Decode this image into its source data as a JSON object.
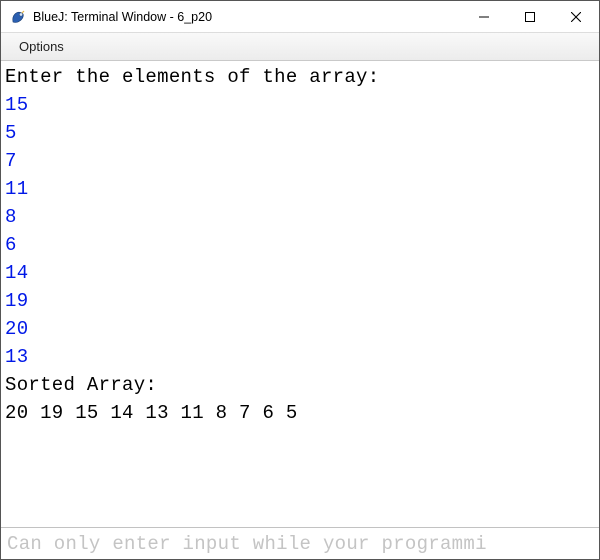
{
  "window": {
    "title": "BlueJ: Terminal Window - 6_p20",
    "controls": {
      "minimize": "—",
      "maximize": "☐",
      "close": "✕"
    }
  },
  "menubar": {
    "options": "Options"
  },
  "terminal": {
    "lines": [
      {
        "text": "Enter the elements of the array:",
        "type": "output"
      },
      {
        "text": "15",
        "type": "input"
      },
      {
        "text": "5",
        "type": "input"
      },
      {
        "text": "7",
        "type": "input"
      },
      {
        "text": "11",
        "type": "input"
      },
      {
        "text": "8",
        "type": "input"
      },
      {
        "text": "6",
        "type": "input"
      },
      {
        "text": "14",
        "type": "input"
      },
      {
        "text": "19",
        "type": "input"
      },
      {
        "text": "20",
        "type": "input"
      },
      {
        "text": "13",
        "type": "input"
      },
      {
        "text": "Sorted Array:",
        "type": "output"
      },
      {
        "text": "20 19 15 14 13 11 8 7 6 5",
        "type": "output"
      }
    ]
  },
  "inputbar": {
    "placeholder": "Can only enter input while your programmi"
  }
}
